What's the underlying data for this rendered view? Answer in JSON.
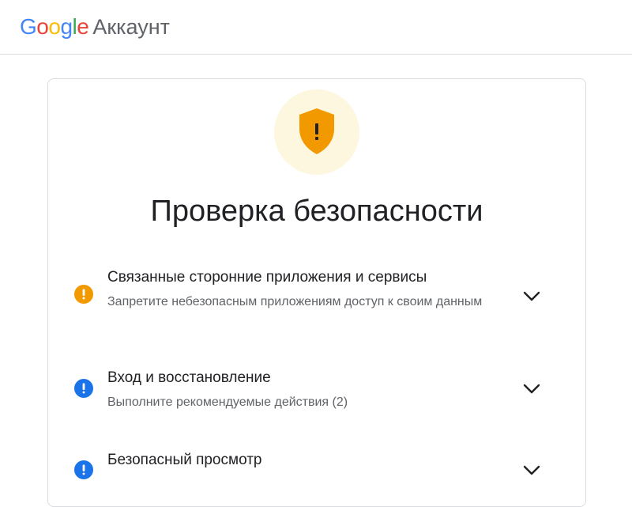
{
  "header": {
    "logo_letters": [
      "G",
      "o",
      "o",
      "g",
      "l",
      "e"
    ],
    "product_name": "Аккаунт"
  },
  "main": {
    "title": "Проверка безопасности",
    "hero_icon": "shield-warning-icon",
    "items": [
      {
        "title": "Связанные сторонние приложения и сервисы",
        "description": "Запретите небезопасным приложениям доступ к своим данным",
        "status": "warning",
        "status_icon": "warning-circle-icon"
      },
      {
        "title": "Вход и восстановление",
        "description": "Выполните рекомендуемые действия (2)",
        "status": "info",
        "status_icon": "info-circle-icon"
      },
      {
        "title": "Безопасный просмотр",
        "description": "",
        "status": "info",
        "status_icon": "info-circle-icon"
      }
    ]
  },
  "colors": {
    "warning": "#F29900",
    "info": "#1A73E8",
    "hero_bg": "#FEF7E0",
    "border": "#DADCE0",
    "text_primary": "#202124",
    "text_secondary": "#5F6368"
  }
}
